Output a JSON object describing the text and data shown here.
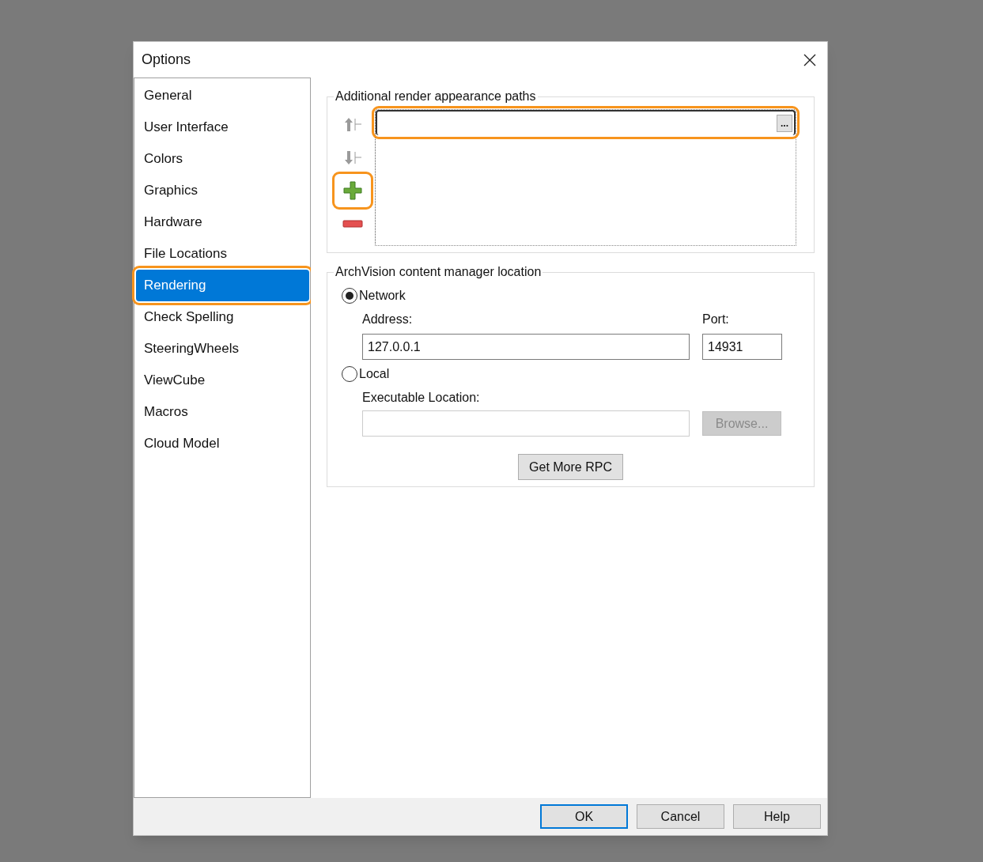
{
  "window": {
    "title": "Options"
  },
  "sidebar": {
    "items": [
      {
        "label": "General",
        "selected": false,
        "highlighted": false
      },
      {
        "label": "User Interface",
        "selected": false,
        "highlighted": false
      },
      {
        "label": "Colors",
        "selected": false,
        "highlighted": false
      },
      {
        "label": "Graphics",
        "selected": false,
        "highlighted": false
      },
      {
        "label": "Hardware",
        "selected": false,
        "highlighted": false
      },
      {
        "label": "File Locations",
        "selected": false,
        "highlighted": false
      },
      {
        "label": "Rendering",
        "selected": true,
        "highlighted": true
      },
      {
        "label": "Check Spelling",
        "selected": false,
        "highlighted": false
      },
      {
        "label": "SteeringWheels",
        "selected": false,
        "highlighted": false
      },
      {
        "label": "ViewCube",
        "selected": false,
        "highlighted": false
      },
      {
        "label": "Macros",
        "selected": false,
        "highlighted": false
      },
      {
        "label": "Cloud Model",
        "selected": false,
        "highlighted": false
      }
    ]
  },
  "render_paths": {
    "title": "Additional render appearance paths",
    "tools": [
      {
        "kind": "move-up",
        "disabled": true,
        "highlighted": false
      },
      {
        "kind": "move-down",
        "disabled": true,
        "highlighted": false
      },
      {
        "kind": "add",
        "disabled": false,
        "highlighted": true
      },
      {
        "kind": "remove",
        "disabled": false,
        "highlighted": false
      }
    ],
    "path_field": {
      "highlighted": true,
      "browse_label": "..."
    }
  },
  "archvision": {
    "title": "ArchVision content manager location",
    "options": [
      {
        "label": "Network",
        "selected": true
      },
      {
        "label": "Local",
        "selected": false
      }
    ],
    "address_label": "Address:",
    "address": "127.0.0.1",
    "port_label": "Port:",
    "port": "14931",
    "executable_label": "Executable Location:",
    "browse_button": {
      "label": "Browse...",
      "disabled": true
    },
    "get_more_button": "Get More RPC"
  },
  "buttons": [
    {
      "label": "OK",
      "default": true
    },
    {
      "label": "Cancel",
      "default": false
    },
    {
      "label": "Help",
      "default": false
    }
  ]
}
